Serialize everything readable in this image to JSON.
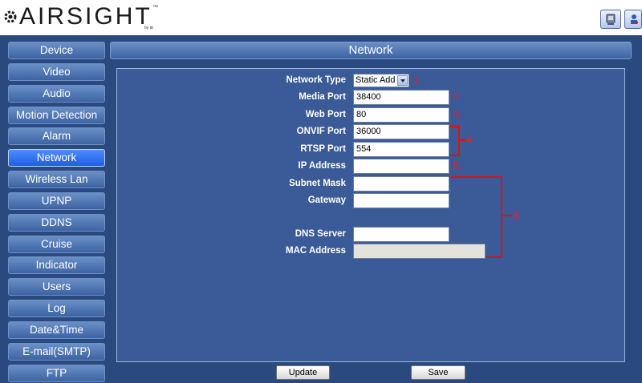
{
  "header": {
    "logo_text": "AIRSIGHT",
    "logo_tm": "™",
    "logo_sub": "by ⊞",
    "buttons": [
      {
        "icon": "pc-icon"
      },
      {
        "icon": "camera-settings-icon"
      }
    ]
  },
  "sidebar": {
    "items": [
      {
        "label": "Device"
      },
      {
        "label": "Video"
      },
      {
        "label": "Audio"
      },
      {
        "label": "Motion Detection"
      },
      {
        "label": "Alarm"
      },
      {
        "label": "Network",
        "active": true
      },
      {
        "label": "Wireless Lan"
      },
      {
        "label": "UPNP"
      },
      {
        "label": "DDNS"
      },
      {
        "label": "Cruise"
      },
      {
        "label": "Indicator"
      },
      {
        "label": "Users"
      },
      {
        "label": "Log"
      },
      {
        "label": "Date&Time"
      },
      {
        "label": "E-mail(SMTP)"
      },
      {
        "label": "FTP"
      }
    ]
  },
  "main": {
    "title": "Network",
    "form": {
      "network_type_label": "Network Type",
      "network_type_value": "Static Add",
      "media_port_label": "Media Port",
      "media_port_value": "38400",
      "web_port_label": "Web Port",
      "web_port_value": "80",
      "onvif_port_label": "ONVIF Port",
      "onvif_port_value": "36000",
      "rtsp_port_label": "RTSP Port",
      "rtsp_port_value": "554",
      "ip_address_label": "IP Address",
      "ip_address_value": "",
      "subnet_mask_label": "Subnet Mask",
      "subnet_mask_value": "",
      "gateway_label": "Gateway",
      "gateway_value": "",
      "dns_server_label": "DNS Server",
      "dns_server_value": "",
      "mac_address_label": "MAC Address",
      "mac_address_value": ""
    },
    "annotations": [
      "1.",
      "2.",
      "3.",
      "4.",
      "5.",
      "6."
    ],
    "update_label": "Update",
    "save_label": "Save"
  },
  "colors": {
    "background": "#2a4a7f",
    "panel": "#3a5b97",
    "active_item": "#2f6cf0",
    "annotation": "#ff1a1a"
  }
}
